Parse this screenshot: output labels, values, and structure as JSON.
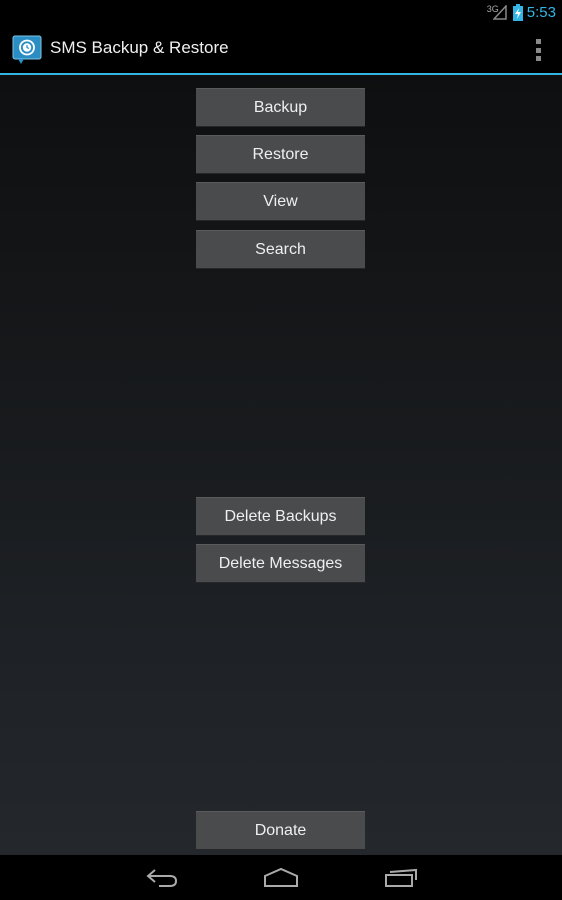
{
  "status_bar": {
    "network_type": "3G",
    "time": "5:53",
    "icons": [
      "signal-icon",
      "battery-charging-icon"
    ]
  },
  "action_bar": {
    "title": "SMS Backup & Restore",
    "icon": "app-logo-icon",
    "overflow_icon": "overflow-menu-icon"
  },
  "buttons": {
    "backup": "Backup",
    "restore": "Restore",
    "view": "View",
    "search": "Search",
    "delete_backups": "Delete Backups",
    "delete_messages": "Delete Messages",
    "donate": "Donate"
  },
  "nav_bar": {
    "icons": [
      "back-icon",
      "home-icon",
      "recent-apps-icon"
    ]
  },
  "colors": {
    "accent": "#33b5e5",
    "button_bg": "#4a4b4c",
    "button_text": "#efefef"
  }
}
